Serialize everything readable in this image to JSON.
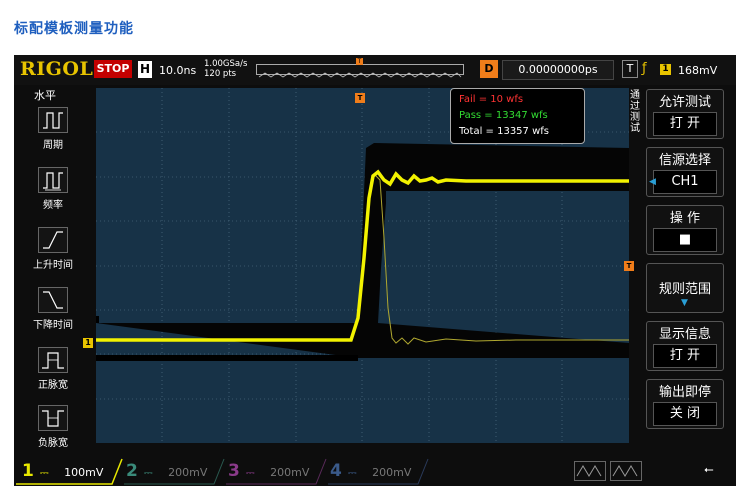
{
  "page_title": "标配模板测量功能",
  "topbar": {
    "logo": "RIGOL",
    "run_state": "STOP",
    "horizontal_label": "H",
    "timebase": "10.0ns",
    "sample_rate": "1.00GSa/s",
    "memory_depth": "120 pts",
    "delay_label": "D",
    "delay_value": "0.00000000ps",
    "trigger_type_label": "T",
    "trigger_channel": "1",
    "trigger_level": "168mV"
  },
  "left_panel": {
    "title": "水平",
    "items": [
      {
        "label": "周期",
        "icon": "period-icon"
      },
      {
        "label": "频率",
        "icon": "frequency-icon"
      },
      {
        "label": "上升时间",
        "icon": "rise-time-icon"
      },
      {
        "label": "下降时间",
        "icon": "fall-time-icon"
      },
      {
        "label": "正脉宽",
        "icon": "positive-width-icon"
      },
      {
        "label": "负脉宽",
        "icon": "negative-width-icon"
      }
    ]
  },
  "stats": {
    "fail": "Fail = 10 wfs",
    "pass": "Pass = 13347 wfs",
    "total": "Total = 13357 wfs",
    "fail_color": "#ff3333",
    "pass_color": "#33dd33",
    "total_color": "#ffffff"
  },
  "markers": {
    "trigger_position": "T",
    "trigger_level": "T",
    "channel1": "1"
  },
  "right_menu": {
    "title": "通过测试",
    "buttons": [
      {
        "title": "允许测试",
        "value": "打 开"
      },
      {
        "title": "信源选择",
        "value": "CH1"
      },
      {
        "title": "操 作",
        "value": "■"
      },
      {
        "title": "规则范围",
        "value": ""
      },
      {
        "title": "显示信息",
        "value": "打 开"
      },
      {
        "title": "输出即停",
        "value": "关 闭"
      }
    ]
  },
  "channels": [
    {
      "num": "1",
      "scale": "100mV",
      "color": "#e8e800",
      "active": true
    },
    {
      "num": "2",
      "scale": "200mV",
      "color": "#3a8a7a",
      "active": false
    },
    {
      "num": "3",
      "scale": "200mV",
      "color": "#8a3a8a",
      "active": false
    },
    {
      "num": "4",
      "scale": "200mV",
      "color": "#3a5a8a",
      "active": false
    }
  ],
  "colors": {
    "grid_bg": "#173247",
    "ch1": "#e8e800",
    "trigger": "#f07d1a",
    "logo": "#e8c400",
    "stop": "#c40000"
  }
}
